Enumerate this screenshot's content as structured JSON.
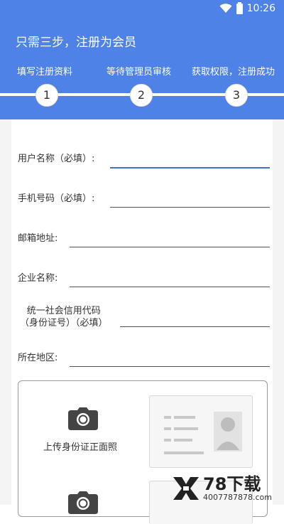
{
  "status_bar": {
    "time": "10:26"
  },
  "header": {
    "title": "只需三步，注册为会员",
    "steps": [
      {
        "label": "填写注册资料",
        "number": "1"
      },
      {
        "label": "等待管理员审核",
        "number": "2"
      },
      {
        "label": "获取权限，注册成功",
        "number": "3"
      }
    ]
  },
  "form": {
    "fields": [
      {
        "label": "用户名称（必填）:",
        "value": ""
      },
      {
        "label": "手机号码（必填）:",
        "value": ""
      },
      {
        "label": "邮箱地址:",
        "value": ""
      },
      {
        "label": "企业名称:",
        "value": ""
      },
      {
        "label_line1": "统一社会信用代码",
        "label_line2": "（身份证号）（必填）",
        "value": ""
      },
      {
        "label": "所在地区:",
        "value": ""
      }
    ]
  },
  "upload": {
    "front_label": "上传身份证正面照"
  },
  "watermark": {
    "brand": "78下载",
    "url": "4007787878.com"
  },
  "icons": [
    "wifi-icon",
    "battery-icon",
    "camera-icon",
    "id-card-placeholder"
  ],
  "colors": {
    "primary": "#4e82e6",
    "focus_underline": "#3f6fcf"
  }
}
